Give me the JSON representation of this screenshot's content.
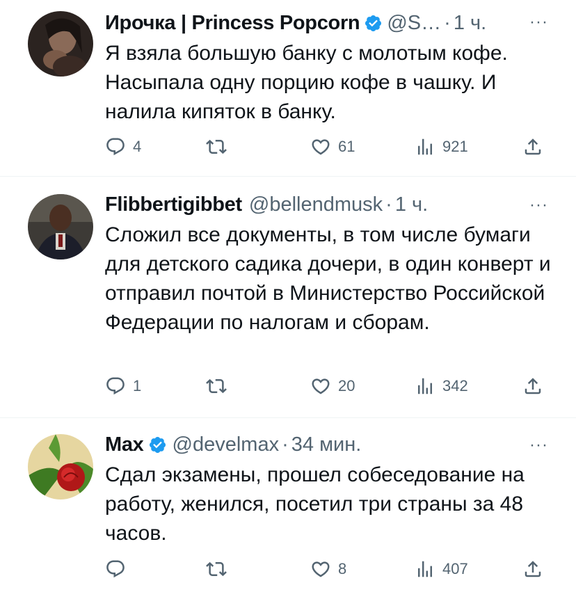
{
  "tweets": [
    {
      "name": "Ирочка | Princess Popcorn",
      "handle": "@S…",
      "separator": "·",
      "time": "1 ч.",
      "verified": true,
      "text": "Я взяла большую банку с молотым кофе. Насыпала одну порцию кофе в чашку. И налила кипяток в банку.",
      "replies": "4",
      "retweets": "",
      "likes": "61",
      "views": "921"
    },
    {
      "name": "Flibbertigibbet",
      "handle": "@bellendmusk",
      "separator": "·",
      "time": "1 ч.",
      "verified": false,
      "text": "Сложил все документы, в том числе бумаги для детского садика дочери, в один конверт и отправил почтой в Министерство Российской Федерации по налогам и сборам.",
      "replies": "1",
      "retweets": "",
      "likes": "20",
      "views": "342"
    },
    {
      "name": "Max",
      "handle": "@develmax",
      "separator": "·",
      "time": "34 мин.",
      "verified": true,
      "text": "Сдал экзамены, прошел собеседование на работу, женился, посетил три страны за 48 часов.",
      "replies": "",
      "retweets": "",
      "likes": "8",
      "views": "407"
    }
  ],
  "more_label": "···",
  "colors": {
    "verified": "#1d9bf0",
    "muted": "#536471",
    "text": "#0f1419"
  },
  "icons": [
    "reply-icon",
    "retweet-icon",
    "like-icon",
    "views-icon",
    "share-icon",
    "verified-icon",
    "more-icon"
  ]
}
